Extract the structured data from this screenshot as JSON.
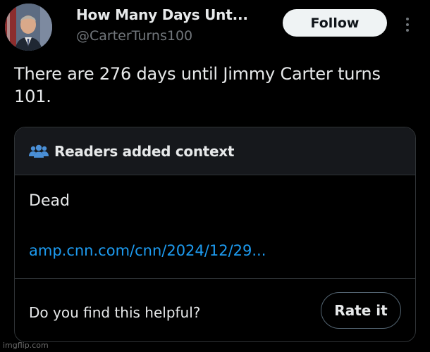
{
  "author": {
    "display_name": "How Many Days Unt...",
    "handle": "@CarterTurns100"
  },
  "actions": {
    "follow_label": "Follow",
    "more_icon": "more-vertical-icon"
  },
  "tweet": {
    "text": "There are 276 days until Jimmy Carter turns 101."
  },
  "community_note": {
    "header_icon": "people-icon",
    "title": "Readers added context",
    "body": "Dead",
    "link": "amp.cnn.com/cnn/2024/12/29...",
    "question": "Do you find this helpful?",
    "rate_label": "Rate it"
  },
  "watermark": "imgflip.com",
  "colors": {
    "background": "#000000",
    "text_primary": "#e7e9ea",
    "text_secondary": "#71767b",
    "link": "#1d9bf0",
    "icon_accent": "#4a8fd6",
    "follow_bg": "#eff3f4",
    "border": "#2f3336"
  }
}
